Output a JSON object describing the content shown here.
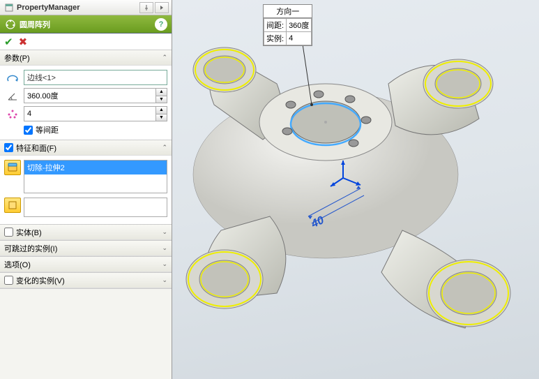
{
  "header": {
    "title": "PropertyManager"
  },
  "feature": {
    "title": "圆周阵列",
    "help": "?"
  },
  "okcancel": {
    "ok": "✔",
    "cancel": "✖"
  },
  "params": {
    "title": "参数(P)",
    "axis": "边线<1>",
    "angle": "360.00度",
    "count": "4",
    "equal_spacing_label": "等间距",
    "equal_spacing": true
  },
  "features_faces": {
    "title": "特征和面(F)",
    "checked": true,
    "item": "切除-拉伸2"
  },
  "bodies": {
    "title": "实体(B)",
    "checked": false
  },
  "skip": {
    "title": "可跳过的实例(I)"
  },
  "options": {
    "title": "选项(O)"
  },
  "varied": {
    "title": "变化的实例(V)",
    "checked": false
  },
  "flag": {
    "header": "方向一",
    "row1_label": "间距:",
    "row1_val": "360度",
    "row2_label": "实例:",
    "row2_val": "4"
  },
  "dimension": "40"
}
